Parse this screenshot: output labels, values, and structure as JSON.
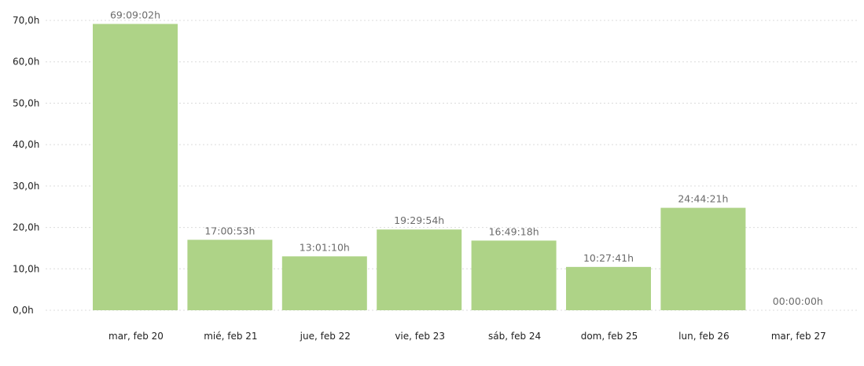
{
  "chart_data": {
    "type": "bar",
    "title": "",
    "xlabel": "",
    "ylabel": "",
    "ylim": [
      0,
      70
    ],
    "y_ticks": [
      0,
      10,
      20,
      30,
      40,
      50,
      60,
      70
    ],
    "y_tick_labels": [
      "0,0h",
      "10,0h",
      "20,0h",
      "30,0h",
      "40,0h",
      "50,0h",
      "60,0h",
      "70,0h"
    ],
    "grid": true,
    "legend": "none",
    "bar_color": "#aed387",
    "categories": [
      "mar, feb 20",
      "mié, feb 21",
      "jue, feb 22",
      "vie, feb 23",
      "sáb, feb 24",
      "dom, feb 25",
      "lun, feb 26",
      "mar, feb 27"
    ],
    "values": [
      69.151,
      17.015,
      13.019,
      19.498,
      16.822,
      10.461,
      24.739,
      0
    ],
    "data_labels": [
      "69:09:02h",
      "17:00:53h",
      "13:01:10h",
      "19:29:54h",
      "16:49:18h",
      "10:27:41h",
      "24:44:21h",
      "00:00:00h"
    ]
  }
}
